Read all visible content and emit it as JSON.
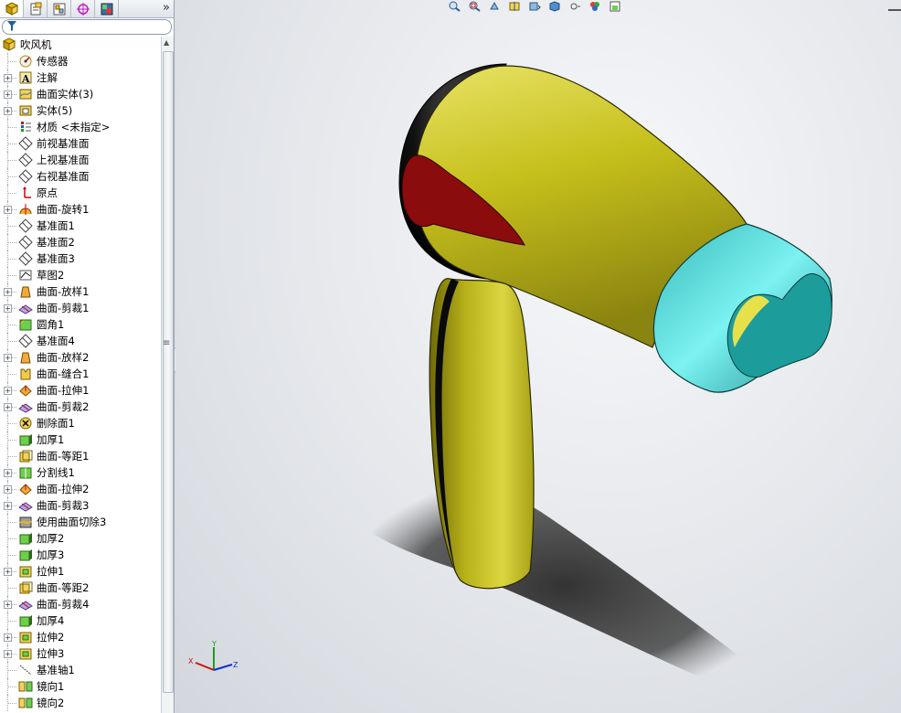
{
  "tree": {
    "root_label": "吹风机",
    "items": [
      {
        "label": "传感器",
        "icon": "sensor-icon",
        "expand": false
      },
      {
        "label": "注解",
        "icon": "annotation-icon",
        "expand": true
      },
      {
        "label": "曲面实体(3)",
        "icon": "surface-body-icon",
        "expand": true
      },
      {
        "label": "实体(5)",
        "icon": "solid-body-icon",
        "expand": true
      },
      {
        "label": "材质 <未指定>",
        "icon": "material-icon",
        "expand": false
      },
      {
        "label": "前视基准面",
        "icon": "plane-icon",
        "expand": false
      },
      {
        "label": "上视基准面",
        "icon": "plane-icon",
        "expand": false
      },
      {
        "label": "右视基准面",
        "icon": "plane-icon",
        "expand": false
      },
      {
        "label": "原点",
        "icon": "origin-icon",
        "expand": false
      },
      {
        "label": "曲面-旋转1",
        "icon": "surface-revolve-icon",
        "expand": true
      },
      {
        "label": "基准面1",
        "icon": "plane-icon",
        "expand": false
      },
      {
        "label": "基准面2",
        "icon": "plane-icon",
        "expand": false
      },
      {
        "label": "基准面3",
        "icon": "plane-icon",
        "expand": false
      },
      {
        "label": "草图2",
        "icon": "sketch-icon",
        "expand": false
      },
      {
        "label": "曲面-放样1",
        "icon": "surface-loft-icon",
        "expand": true
      },
      {
        "label": "曲面-剪裁1",
        "icon": "surface-trim-icon",
        "expand": true
      },
      {
        "label": "圆角1",
        "icon": "fillet-icon",
        "expand": false
      },
      {
        "label": "基准面4",
        "icon": "plane-icon",
        "expand": false
      },
      {
        "label": "曲面-放样2",
        "icon": "surface-loft-icon",
        "expand": true
      },
      {
        "label": "曲面-缝合1",
        "icon": "surface-knit-icon",
        "expand": false
      },
      {
        "label": "曲面-拉伸1",
        "icon": "surface-extrude-icon",
        "expand": true
      },
      {
        "label": "曲面-剪裁2",
        "icon": "surface-trim-icon",
        "expand": true
      },
      {
        "label": "删除面1",
        "icon": "delete-face-icon",
        "expand": false
      },
      {
        "label": "加厚1",
        "icon": "thicken-icon",
        "expand": false
      },
      {
        "label": "曲面-等距1",
        "icon": "surface-offset-icon",
        "expand": false
      },
      {
        "label": "分割线1",
        "icon": "split-line-icon",
        "expand": true
      },
      {
        "label": "曲面-拉伸2",
        "icon": "surface-extrude-icon",
        "expand": true
      },
      {
        "label": "曲面-剪裁3",
        "icon": "surface-trim-icon",
        "expand": true
      },
      {
        "label": "使用曲面切除3",
        "icon": "surface-cut-icon",
        "expand": false
      },
      {
        "label": "加厚2",
        "icon": "thicken-icon",
        "expand": false
      },
      {
        "label": "加厚3",
        "icon": "thicken-icon",
        "expand": false
      },
      {
        "label": "拉伸1",
        "icon": "extrude-icon",
        "expand": true
      },
      {
        "label": "曲面-等距2",
        "icon": "surface-offset-icon",
        "expand": false
      },
      {
        "label": "曲面-剪裁4",
        "icon": "surface-trim-icon",
        "expand": true
      },
      {
        "label": "加厚4",
        "icon": "thicken-icon",
        "expand": false
      },
      {
        "label": "拉伸2",
        "icon": "extrude-icon",
        "expand": true
      },
      {
        "label": "拉伸3",
        "icon": "extrude-icon",
        "expand": true
      },
      {
        "label": "基准轴1",
        "icon": "axis-icon",
        "expand": false
      },
      {
        "label": "镜向1",
        "icon": "mirror-icon",
        "expand": false
      },
      {
        "label": "镜向2",
        "icon": "mirror-icon",
        "expand": false
      }
    ]
  },
  "tabs": [
    "feature-manager-icon",
    "property-manager-icon",
    "configuration-manager-icon",
    "dimxpert-icon",
    "display-manager-icon"
  ],
  "view_toolbar": [
    "zoom-to-fit-icon",
    "zoom-area-icon",
    "previous-view-icon",
    "section-view-icon",
    "view-orientation-icon",
    "display-style-icon",
    "hide-show-icon",
    "edit-appearance-icon",
    "scene-icon"
  ],
  "triad": {
    "x": "X",
    "y": "Y",
    "z": "Z"
  },
  "colors": {
    "body": "#c8c21e",
    "nozzle": "#2aa8a8",
    "vent": "#8b0c0c",
    "cap": "#111111"
  }
}
